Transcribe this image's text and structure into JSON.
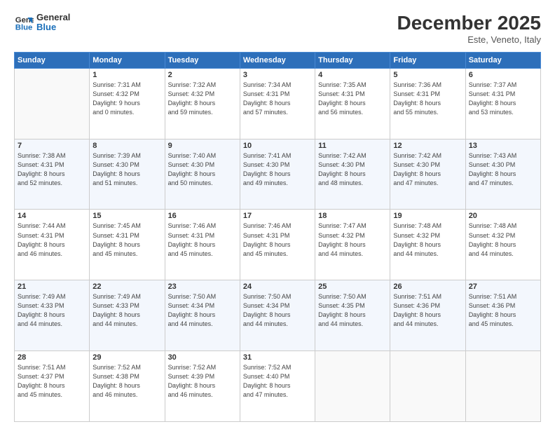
{
  "header": {
    "logo_line1": "General",
    "logo_line2": "Blue",
    "month": "December 2025",
    "location": "Este, Veneto, Italy"
  },
  "days_of_week": [
    "Sunday",
    "Monday",
    "Tuesday",
    "Wednesday",
    "Thursday",
    "Friday",
    "Saturday"
  ],
  "weeks": [
    [
      {
        "day": "",
        "info": ""
      },
      {
        "day": "1",
        "info": "Sunrise: 7:31 AM\nSunset: 4:32 PM\nDaylight: 9 hours\nand 0 minutes."
      },
      {
        "day": "2",
        "info": "Sunrise: 7:32 AM\nSunset: 4:32 PM\nDaylight: 8 hours\nand 59 minutes."
      },
      {
        "day": "3",
        "info": "Sunrise: 7:34 AM\nSunset: 4:31 PM\nDaylight: 8 hours\nand 57 minutes."
      },
      {
        "day": "4",
        "info": "Sunrise: 7:35 AM\nSunset: 4:31 PM\nDaylight: 8 hours\nand 56 minutes."
      },
      {
        "day": "5",
        "info": "Sunrise: 7:36 AM\nSunset: 4:31 PM\nDaylight: 8 hours\nand 55 minutes."
      },
      {
        "day": "6",
        "info": "Sunrise: 7:37 AM\nSunset: 4:31 PM\nDaylight: 8 hours\nand 53 minutes."
      }
    ],
    [
      {
        "day": "7",
        "info": "Sunrise: 7:38 AM\nSunset: 4:31 PM\nDaylight: 8 hours\nand 52 minutes."
      },
      {
        "day": "8",
        "info": "Sunrise: 7:39 AM\nSunset: 4:30 PM\nDaylight: 8 hours\nand 51 minutes."
      },
      {
        "day": "9",
        "info": "Sunrise: 7:40 AM\nSunset: 4:30 PM\nDaylight: 8 hours\nand 50 minutes."
      },
      {
        "day": "10",
        "info": "Sunrise: 7:41 AM\nSunset: 4:30 PM\nDaylight: 8 hours\nand 49 minutes."
      },
      {
        "day": "11",
        "info": "Sunrise: 7:42 AM\nSunset: 4:30 PM\nDaylight: 8 hours\nand 48 minutes."
      },
      {
        "day": "12",
        "info": "Sunrise: 7:42 AM\nSunset: 4:30 PM\nDaylight: 8 hours\nand 47 minutes."
      },
      {
        "day": "13",
        "info": "Sunrise: 7:43 AM\nSunset: 4:30 PM\nDaylight: 8 hours\nand 47 minutes."
      }
    ],
    [
      {
        "day": "14",
        "info": "Sunrise: 7:44 AM\nSunset: 4:31 PM\nDaylight: 8 hours\nand 46 minutes."
      },
      {
        "day": "15",
        "info": "Sunrise: 7:45 AM\nSunset: 4:31 PM\nDaylight: 8 hours\nand 45 minutes."
      },
      {
        "day": "16",
        "info": "Sunrise: 7:46 AM\nSunset: 4:31 PM\nDaylight: 8 hours\nand 45 minutes."
      },
      {
        "day": "17",
        "info": "Sunrise: 7:46 AM\nSunset: 4:31 PM\nDaylight: 8 hours\nand 45 minutes."
      },
      {
        "day": "18",
        "info": "Sunrise: 7:47 AM\nSunset: 4:32 PM\nDaylight: 8 hours\nand 44 minutes."
      },
      {
        "day": "19",
        "info": "Sunrise: 7:48 AM\nSunset: 4:32 PM\nDaylight: 8 hours\nand 44 minutes."
      },
      {
        "day": "20",
        "info": "Sunrise: 7:48 AM\nSunset: 4:32 PM\nDaylight: 8 hours\nand 44 minutes."
      }
    ],
    [
      {
        "day": "21",
        "info": "Sunrise: 7:49 AM\nSunset: 4:33 PM\nDaylight: 8 hours\nand 44 minutes."
      },
      {
        "day": "22",
        "info": "Sunrise: 7:49 AM\nSunset: 4:33 PM\nDaylight: 8 hours\nand 44 minutes."
      },
      {
        "day": "23",
        "info": "Sunrise: 7:50 AM\nSunset: 4:34 PM\nDaylight: 8 hours\nand 44 minutes."
      },
      {
        "day": "24",
        "info": "Sunrise: 7:50 AM\nSunset: 4:34 PM\nDaylight: 8 hours\nand 44 minutes."
      },
      {
        "day": "25",
        "info": "Sunrise: 7:50 AM\nSunset: 4:35 PM\nDaylight: 8 hours\nand 44 minutes."
      },
      {
        "day": "26",
        "info": "Sunrise: 7:51 AM\nSunset: 4:36 PM\nDaylight: 8 hours\nand 44 minutes."
      },
      {
        "day": "27",
        "info": "Sunrise: 7:51 AM\nSunset: 4:36 PM\nDaylight: 8 hours\nand 45 minutes."
      }
    ],
    [
      {
        "day": "28",
        "info": "Sunrise: 7:51 AM\nSunset: 4:37 PM\nDaylight: 8 hours\nand 45 minutes."
      },
      {
        "day": "29",
        "info": "Sunrise: 7:52 AM\nSunset: 4:38 PM\nDaylight: 8 hours\nand 46 minutes."
      },
      {
        "day": "30",
        "info": "Sunrise: 7:52 AM\nSunset: 4:39 PM\nDaylight: 8 hours\nand 46 minutes."
      },
      {
        "day": "31",
        "info": "Sunrise: 7:52 AM\nSunset: 4:40 PM\nDaylight: 8 hours\nand 47 minutes."
      },
      {
        "day": "",
        "info": ""
      },
      {
        "day": "",
        "info": ""
      },
      {
        "day": "",
        "info": ""
      }
    ]
  ]
}
